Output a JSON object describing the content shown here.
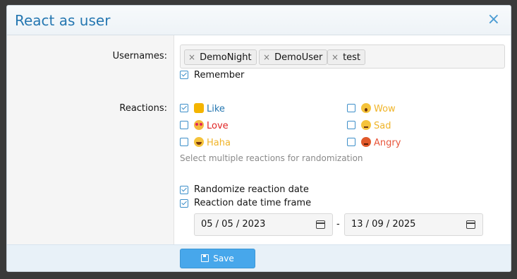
{
  "dialog": {
    "title": "React as user",
    "close_icon": "×"
  },
  "usernames": {
    "label": "Usernames:",
    "tokens": [
      "DemoNight",
      "DemoUser",
      "test"
    ],
    "token_remove_glyph": "×",
    "remember": {
      "label": "Remember",
      "checked": true
    }
  },
  "reactions": {
    "label": "Reactions:",
    "items": [
      {
        "name": "Like",
        "checked": true,
        "color": "#2577b1",
        "icon": "thumbs-up-icon"
      },
      {
        "name": "Love",
        "checked": false,
        "color": "#e02424",
        "icon": "heart-eyes-icon"
      },
      {
        "name": "Haha",
        "checked": false,
        "color": "#f0b429",
        "icon": "laughing-icon"
      },
      {
        "name": "Wow",
        "checked": false,
        "color": "#f0b429",
        "icon": "surprised-icon"
      },
      {
        "name": "Sad",
        "checked": false,
        "color": "#f0b429",
        "icon": "sad-icon"
      },
      {
        "name": "Angry",
        "checked": false,
        "color": "#e8553a",
        "icon": "angry-icon"
      }
    ],
    "hint": "Select multiple reactions for randomization"
  },
  "date_options": {
    "randomize": {
      "label": "Randomize reaction date",
      "checked": true
    },
    "timeframe": {
      "label": "Reaction date time frame",
      "checked": true
    },
    "from": "05 / 05 / 2023",
    "separator": "-",
    "to": "13 / 09 / 2025"
  },
  "footer": {
    "save_label": "Save"
  }
}
